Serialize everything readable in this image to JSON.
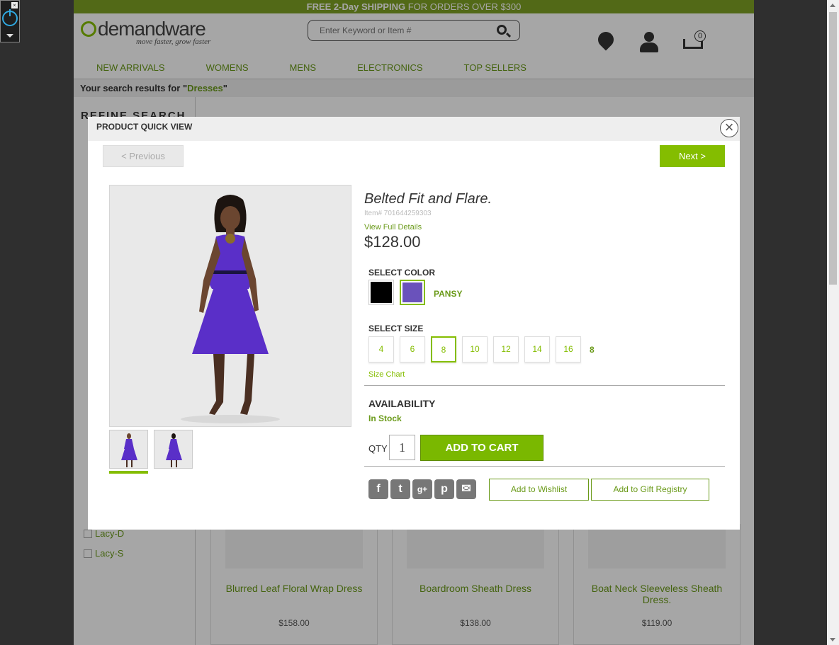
{
  "promo": {
    "bold": "FREE 2-Day SHIPPING",
    "rest": "FOR ORDERS OVER $300"
  },
  "logo": {
    "name": "demandware",
    "tagline": "move faster, grow faster"
  },
  "search": {
    "placeholder": "Enter Keyword or Item #"
  },
  "cart": {
    "count": "0"
  },
  "nav": [
    "NEW ARRIVALS",
    "WOMENS",
    "MENS",
    "ELECTRONICS",
    "TOP SELLERS"
  ],
  "results": {
    "prefix": "Your search results for \"",
    "query": "Dresses",
    "suffix": "\""
  },
  "sidebar": {
    "title": "REFINE SEARCH",
    "items": [
      "Lacy-D",
      "Lacy-S"
    ]
  },
  "products": [
    {
      "name": "Blurred Leaf Floral Wrap Dress",
      "price": "$158.00"
    },
    {
      "name": "Boardroom Sheath Dress",
      "price": "$138.00"
    },
    {
      "name": "Boat Neck Sleeveless Sheath Dress.",
      "price": "$119.00"
    }
  ],
  "modal": {
    "title": "PRODUCT QUICK VIEW",
    "close": "×",
    "prev": "< Previous",
    "next": "Next >",
    "product": {
      "name": "Belted Fit and Flare.",
      "item_no": "Item# 701644259303",
      "view_full": "View Full Details",
      "price": "$128.00",
      "select_color": "SELECT COLOR",
      "colors": [
        {
          "name": "Black",
          "hex": "#000000"
        },
        {
          "name": "PANSY",
          "hex": "#6a52bb"
        }
      ],
      "selected_color": "PANSY",
      "select_size": "SELECT SIZE",
      "sizes": [
        "4",
        "6",
        "8",
        "10",
        "12",
        "14",
        "16"
      ],
      "selected_size": "8",
      "size_chart": "Size Chart",
      "availability": "AVAILABILITY",
      "stock": "In Stock",
      "qty_label": "QTY",
      "qty": "1",
      "add_to_cart": "ADD TO CART",
      "social": [
        "f",
        "t",
        "g+",
        "p",
        "✉"
      ],
      "wishlist": "Add to Wishlist",
      "registry": "Add to Gift Registry"
    }
  },
  "colors": {
    "accent": "#84bd00",
    "link": "#6a9a19",
    "promo": "#7fa124"
  }
}
